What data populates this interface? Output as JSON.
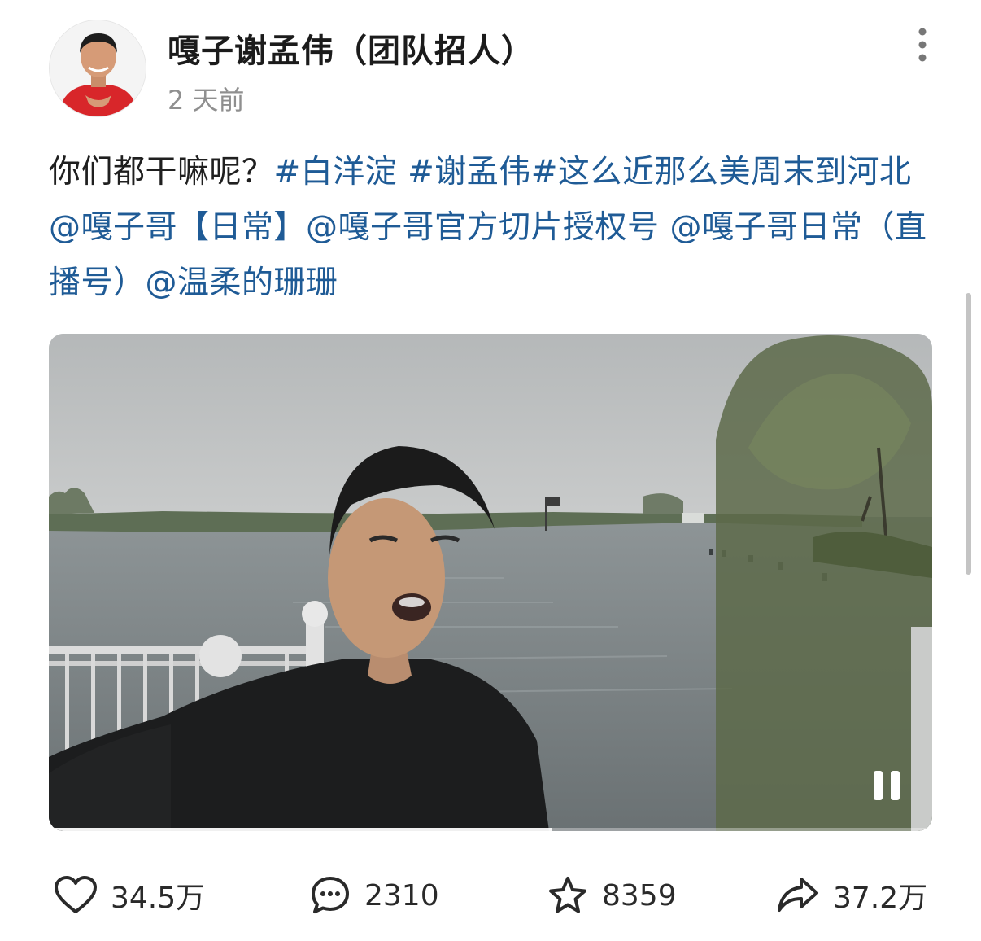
{
  "author": {
    "name": "嘎子谢孟伟（团队招人）",
    "time": "2 天前"
  },
  "post": {
    "text": "你们都干嘛呢？",
    "hashtags": [
      "#白洋淀",
      "#谢孟伟",
      "#这么近那么美周末到河北"
    ],
    "mentions": [
      "@嘎子哥【日常】",
      "@嘎子哥官方切片授权号",
      "@嘎子哥日常（直播号）",
      "@温柔的珊珊"
    ]
  },
  "video": {
    "state": "playing",
    "progress": 0.57
  },
  "actions": {
    "likes": "34.5万",
    "comments": "2310",
    "favorites": "8359",
    "shares": "37.2万"
  },
  "colors": {
    "link": "#1f5b96",
    "secondary_text": "#8f8f8f"
  },
  "icons": [
    "more-vertical-icon",
    "pause-icon",
    "heart-icon",
    "comment-icon",
    "star-icon",
    "share-icon"
  ]
}
